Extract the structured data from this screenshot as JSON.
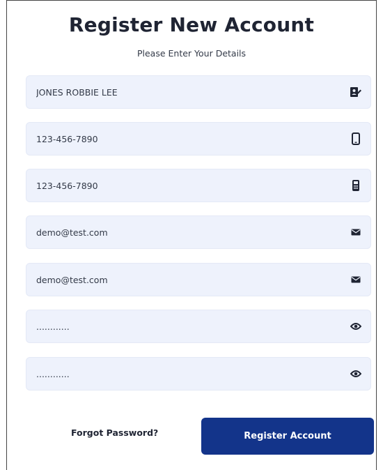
{
  "form": {
    "title": "Register New Account",
    "subtitle": "Please Enter Your Details",
    "fields": [
      {
        "value": "JONES ROBBIE LEE",
        "icon": "id-card-edit-icon"
      },
      {
        "value": "123-456-7890",
        "icon": "mobile-phone-icon"
      },
      {
        "value": "123-456-7890",
        "icon": "landline-phone-icon"
      },
      {
        "value": "demo@test.com",
        "icon": "envelope-icon"
      },
      {
        "value": "demo@test.com",
        "icon": "envelope-icon"
      },
      {
        "value": "............",
        "icon": "eye-icon"
      },
      {
        "value": "............",
        "icon": "eye-icon"
      }
    ],
    "forgot_label": "Forgot Password?",
    "register_label": "Register Account"
  },
  "colors": {
    "field_bg": "#eef2fc",
    "button_bg": "#13348a",
    "text": "#1f2433"
  }
}
